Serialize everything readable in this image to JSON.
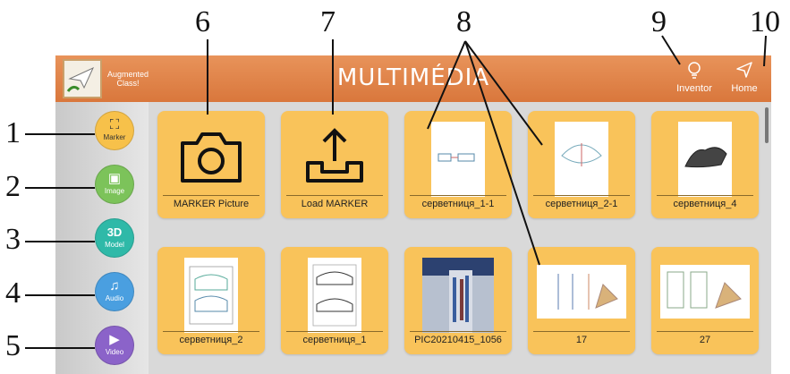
{
  "callouts": [
    "1",
    "2",
    "3",
    "4",
    "5",
    "6",
    "7",
    "8",
    "9",
    "10"
  ],
  "header": {
    "logo_text_line1": "Augmented",
    "logo_text_line2": "Class!",
    "title": "MULTIMÉDIA",
    "inventor_label": "Inventor",
    "home_label": "Home"
  },
  "sidebar": {
    "items": [
      {
        "label": "Marker",
        "color": "#f7c14a"
      },
      {
        "label": "Image",
        "color": "#7cc35a"
      },
      {
        "label": "Model",
        "color": "#2fb9a8",
        "glyph": "3D"
      },
      {
        "label": "Audio",
        "color": "#4a9fe0"
      },
      {
        "label": "Video",
        "color": "#8b63c9"
      }
    ]
  },
  "tiles": [
    {
      "caption": "MARKER Picture"
    },
    {
      "caption": "Load MARKER"
    },
    {
      "caption": "серветниця_1-1"
    },
    {
      "caption": "серветниця_2-1"
    },
    {
      "caption": "серветниця_4"
    },
    {
      "caption": "серветниця_2"
    },
    {
      "caption": "серветниця_1"
    },
    {
      "caption": "PIC20210415_1056"
    },
    {
      "caption": "17"
    },
    {
      "caption": "27"
    }
  ],
  "colors": {
    "topbar": "#e0844a",
    "tile": "#f9c35a",
    "sidebar": "#d6d6d6"
  }
}
